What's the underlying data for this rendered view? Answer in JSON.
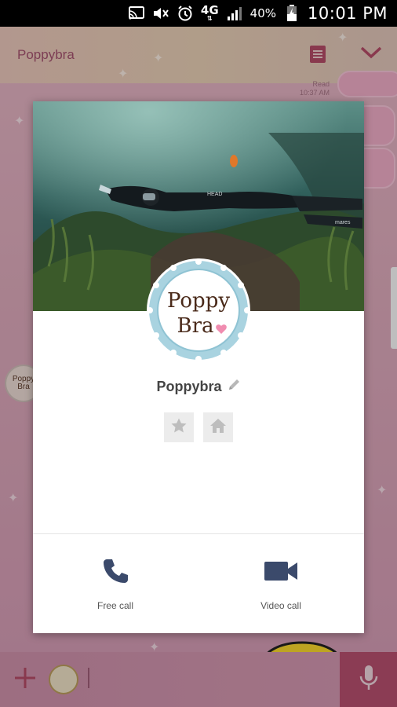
{
  "status_bar": {
    "network_label": "4G",
    "battery_percent": "40%",
    "time": "10:01 PM",
    "icons": [
      "cast-icon",
      "mute-icon",
      "alarm-icon",
      "signal-icon",
      "battery-charging-icon"
    ]
  },
  "chat": {
    "title": "Poppybra",
    "read_label": "Read",
    "read_time": "10:37 AM"
  },
  "profile": {
    "name": "Poppybra",
    "logo_line1": "Poppy",
    "logo_line2": "Bra",
    "actions": [
      {
        "label": "Free call",
        "icon": "phone-icon"
      },
      {
        "label": "Video call",
        "icon": "video-camera-icon"
      }
    ]
  },
  "colors": {
    "accent": "#b34e6c",
    "icon_dark": "#3b4a6b",
    "logo_ring": "#a9d3e0",
    "logo_text": "#4a2a1a",
    "heart": "#f08cb0"
  }
}
